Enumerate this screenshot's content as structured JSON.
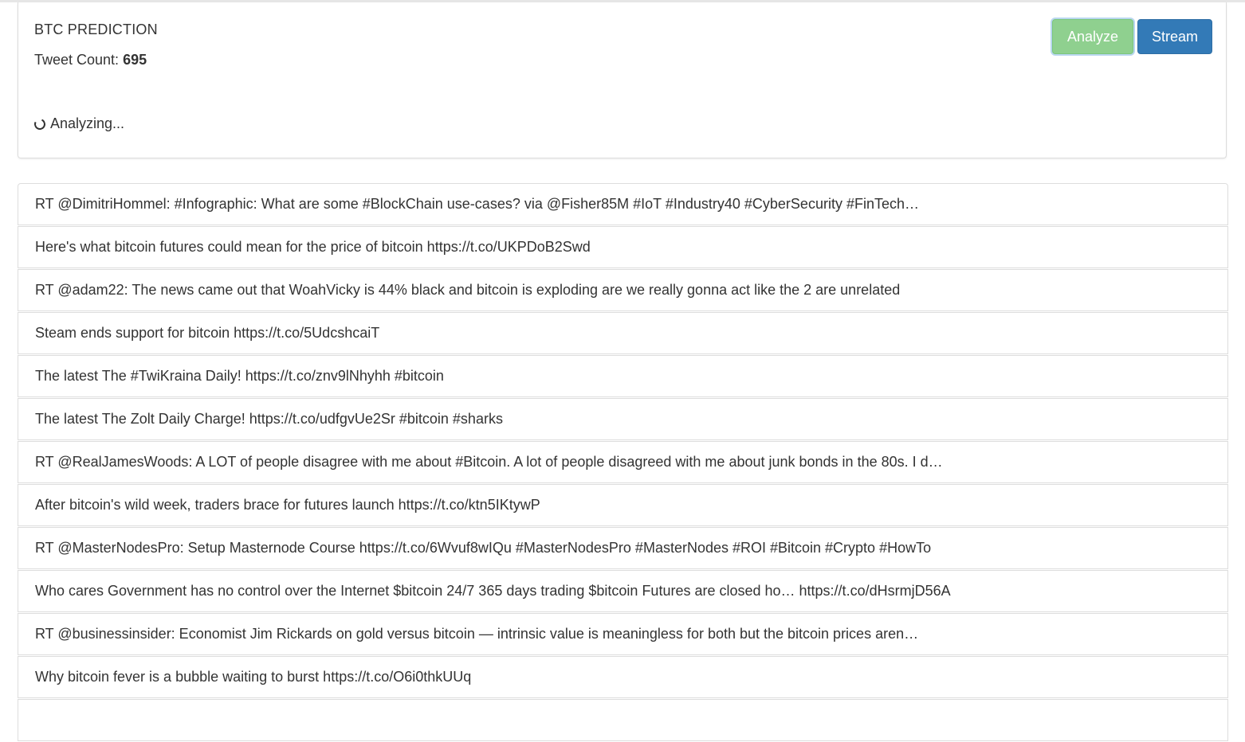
{
  "header": {
    "title": "BTC PREDICTION",
    "tweet_count_label": "Tweet Count:",
    "tweet_count_value": "695",
    "status_text": "Analyzing...",
    "status_icon": "spinner-icon"
  },
  "toolbar": {
    "analyze_label": "Analyze",
    "stream_label": "Stream",
    "analyze_color": "#8fd08f",
    "stream_color": "#337ab7"
  },
  "tweets": [
    "RT @DimitriHommel: #Infographic: What are some #BlockChain use-cases? via @Fisher85M #IoT #Industry40 #CyberSecurity #FinTech…",
    "Here's what bitcoin futures could mean for the price of bitcoin https://t.co/UKPDoB2Swd",
    "RT @adam22: The news came out that WoahVicky is 44% black and bitcoin is exploding are we really gonna act like the 2 are unrelated",
    "Steam ends support for bitcoin https://t.co/5UdcshcaiT",
    "The latest The #TwiKraina Daily! https://t.co/znv9lNhyhh #bitcoin",
    "The latest The Zolt Daily Charge! https://t.co/udfgvUe2Sr #bitcoin #sharks",
    "RT @RealJamesWoods: A LOT of people disagree with me about #Bitcoin. A lot of people disagreed with me about junk bonds in the 80s. I d…",
    "After bitcoin's wild week, traders brace for futures launch https://t.co/ktn5IKtywP",
    "RT @MasterNodesPro: Setup Masternode Course https://t.co/6Wvuf8wIQu #MasterNodesPro #MasterNodes #ROI #Bitcoin #Crypto #HowTo",
    "Who cares Government has no control over the Internet $bitcoin 24/7 365 days trading $bitcoin Futures are closed ho… https://t.co/dHsrmjD56A",
    "RT @businessinsider: Economist Jim Rickards on gold versus bitcoin — intrinsic value is meaningless for both but the bitcoin prices aren…",
    "Why bitcoin fever is a bubble waiting to burst https://t.co/O6i0thkUUq",
    ""
  ]
}
